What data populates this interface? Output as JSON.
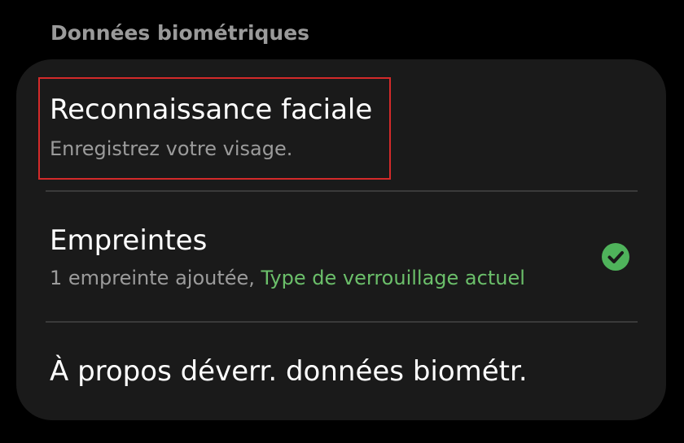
{
  "section": {
    "title": "Données biométriques"
  },
  "items": [
    {
      "title": "Reconnaissance faciale",
      "subtitle": "Enregistrez votre visage."
    },
    {
      "title": "Empreintes",
      "subtitle_prefix": "1 empreinte ajoutée, ",
      "subtitle_accent": "Type de verrouillage actuel",
      "status_icon": "check-circle-icon"
    },
    {
      "title": "À propos déverr. données biométr."
    }
  ],
  "colors": {
    "background": "#000000",
    "card": "#1a1a1a",
    "accent": "#6bbf6a",
    "check": "#4fb35b",
    "highlight": "#d42a2a"
  }
}
